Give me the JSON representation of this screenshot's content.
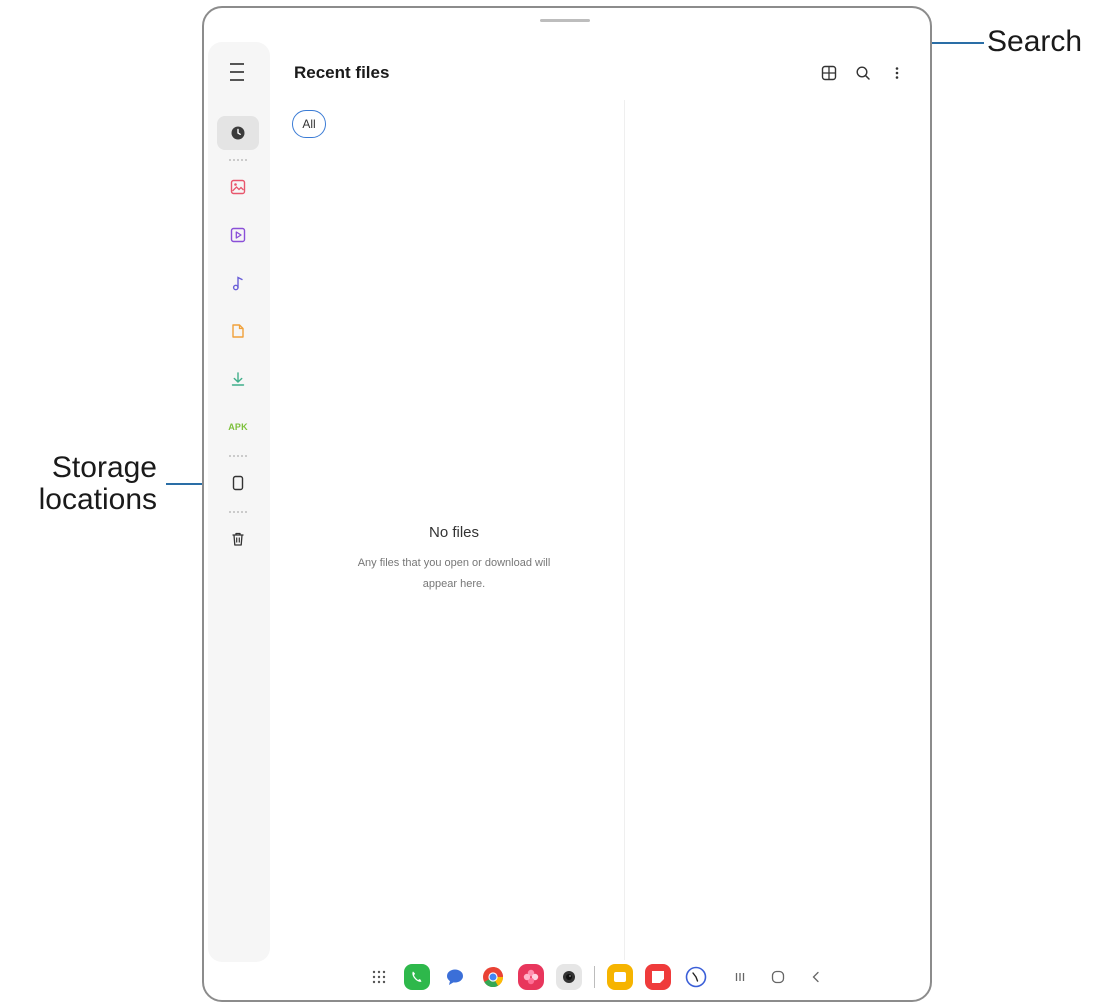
{
  "header": {
    "title": "Recent files"
  },
  "filters": {
    "all_label": "All"
  },
  "empty_state": {
    "title": "No files",
    "line1": "Any files that you open or download will",
    "line2": "appear here."
  },
  "sidebar": {
    "items": [
      {
        "name": "recent",
        "icon": "clock-icon"
      },
      {
        "name": "images",
        "icon": "image-icon"
      },
      {
        "name": "videos",
        "icon": "video-icon"
      },
      {
        "name": "audio",
        "icon": "music-note-icon"
      },
      {
        "name": "documents",
        "icon": "document-icon"
      },
      {
        "name": "downloads",
        "icon": "download-icon"
      },
      {
        "name": "apk",
        "icon": "apk-icon",
        "label": "APK"
      },
      {
        "name": "internal-storage",
        "icon": "phone-storage-icon"
      },
      {
        "name": "trash",
        "icon": "trash-icon"
      }
    ]
  },
  "toolbar": {
    "icons": [
      "grid-view-icon",
      "search-icon",
      "more-options-icon"
    ]
  },
  "dock": {
    "apps": [
      "apps-grid-icon",
      "phone-icon",
      "messages-icon",
      "chrome-icon",
      "gallery-icon",
      "camera-icon",
      "my-files-icon",
      "notes-icon",
      "clock-app-icon"
    ],
    "nav": [
      "recents-icon",
      "home-icon",
      "back-icon"
    ]
  },
  "callouts": {
    "search": "Search",
    "storage_line1": "Storage",
    "storage_line2": "locations"
  },
  "colors": {
    "accent": "#3a7bd5",
    "callout_line": "#2a6ea6",
    "apk": "#7cc03a",
    "images": "#e8566c",
    "videos": "#8a4fd8",
    "audio": "#6a5fd8",
    "documents": "#f0a13a",
    "downloads": "#3fae8a"
  }
}
